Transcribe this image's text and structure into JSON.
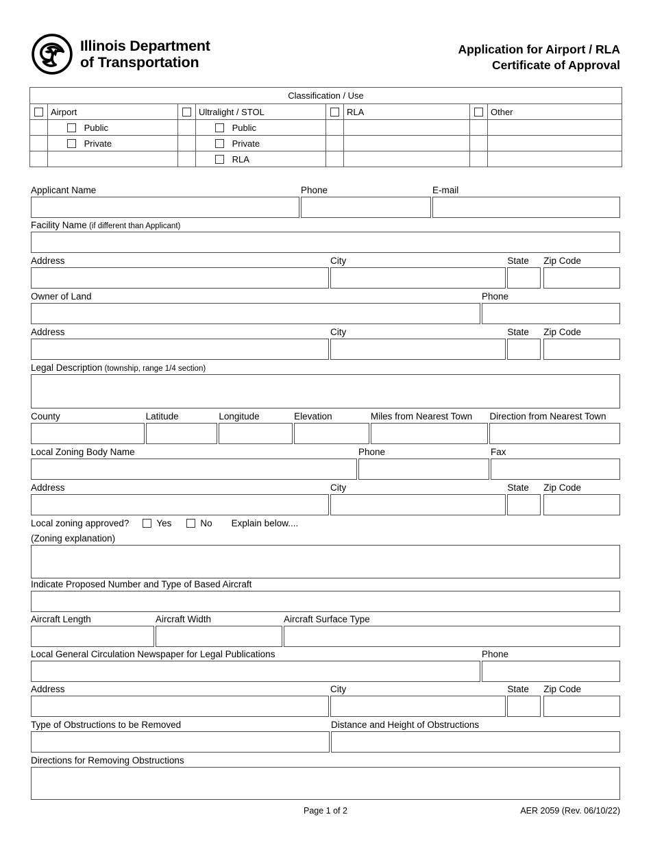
{
  "header": {
    "agency_name": "Illinois Department\nof Transportation",
    "logo_icon": "idot-triskelion-logo",
    "title_line1": "Application for Airport / RLA",
    "title_line2": "Certificate of Approval"
  },
  "classification": {
    "caption": "Classification / Use",
    "columns": [
      {
        "label": "Airport",
        "sub": [
          "Public",
          "Private"
        ]
      },
      {
        "label": "Ultralight / STOL",
        "sub": [
          "Public",
          "Private",
          "RLA"
        ]
      },
      {
        "label": "RLA",
        "sub": []
      },
      {
        "label": "Other",
        "sub": []
      }
    ]
  },
  "fields": {
    "applicant_name": "Applicant Name",
    "phone": "Phone",
    "email": "E-mail",
    "facility_name": "Facility Name",
    "facility_name_note": " (if different than Applicant)",
    "address": "Address",
    "city": "City",
    "state": "State",
    "zip_code": "Zip Code",
    "owner_of_land": "Owner of Land",
    "legal_description": "Legal Description",
    "legal_description_note": " (township, range 1/4 section)",
    "county": "County",
    "latitude": "Latitude",
    "longitude": "Longitude",
    "elevation": "Elevation",
    "miles_from_nearest_town": "Miles from Nearest Town",
    "direction_from_nearest_town": "Direction from Nearest Town",
    "local_zoning_body_name": "Local Zoning Body Name",
    "fax": "Fax",
    "local_zoning_approved": "Local zoning approved?",
    "yes": "Yes",
    "no": "No",
    "explain_below": "Explain below....",
    "zoning_explanation": "(Zoning explanation)",
    "based_aircraft": "Indicate Proposed Number and Type of Based Aircraft",
    "aircraft_length": "Aircraft Length",
    "aircraft_width": "Aircraft Width",
    "aircraft_surface_type": "Aircraft Surface Type",
    "newspaper": "Local General Circulation Newspaper for Legal Publications",
    "type_of_obstructions": "Type of Obstructions to be Removed",
    "distance_height_obstructions": "Distance and Height of Obstructions",
    "directions_removing_obstructions": "Directions for Removing Obstructions"
  },
  "values": {
    "applicant_name": "",
    "phone": "",
    "email": "",
    "facility_name": "",
    "applicant_address": "",
    "applicant_city": "",
    "applicant_state": "",
    "applicant_zip": "",
    "owner_of_land": "",
    "owner_phone": "",
    "owner_address": "",
    "owner_city": "",
    "owner_state": "",
    "owner_zip": "",
    "legal_description": "",
    "county": "",
    "latitude": "",
    "longitude": "",
    "elevation": "",
    "miles_from_nearest_town": "",
    "direction_from_nearest_town": "",
    "zoning_body_name": "",
    "zoning_phone": "",
    "zoning_fax": "",
    "zoning_address": "",
    "zoning_city": "",
    "zoning_state": "",
    "zoning_zip": "",
    "zoning_explanation": "",
    "based_aircraft": "",
    "aircraft_length": "",
    "aircraft_width": "",
    "aircraft_surface_type": "",
    "newspaper": "",
    "newspaper_phone": "",
    "newspaper_address": "",
    "newspaper_city": "",
    "newspaper_state": "",
    "newspaper_zip": "",
    "type_of_obstructions": "",
    "distance_height_obstructions": "",
    "directions_removing_obstructions": ""
  },
  "checkboxes": {
    "zoning_yes": false,
    "zoning_no": false
  },
  "footer": {
    "page_number": "Page 1 of 2",
    "form_id": "AER 2059 (Rev. 06/10/22)"
  },
  "colors": {
    "ink": "#000000",
    "border": "#4a4a4a",
    "table_border": "#595959",
    "page_background": "#ffffff"
  }
}
